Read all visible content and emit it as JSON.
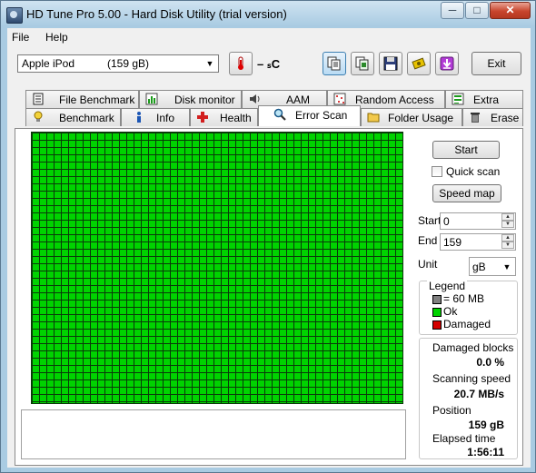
{
  "window": {
    "title": "HD Tune Pro 5.00 - Hard Disk Utility (trial version)",
    "controls": {
      "minimize": "─",
      "maximize": "□",
      "close": "✕"
    }
  },
  "menu": {
    "file": "File",
    "help": "Help"
  },
  "toolbar": {
    "drive_brand": "Apple",
    "drive_model": "iPod",
    "drive_size": "(159 gB)",
    "temperature": "– ₛC",
    "exit_label": "Exit"
  },
  "tabs": {
    "row1": [
      "File Benchmark",
      "Disk monitor",
      "AAM",
      "Random Access",
      "Extra tests"
    ],
    "row2": [
      "Benchmark",
      "Info",
      "Health",
      "Error Scan",
      "Folder Usage",
      "Erase"
    ],
    "selected": "Error Scan"
  },
  "scan": {
    "start_button": "Start",
    "quick_scan_label": "Quick scan",
    "quick_scan_checked": false,
    "speed_map_button": "Speed map",
    "start_label": "Start",
    "start_value": "0",
    "end_label": "End",
    "end_value": "159",
    "unit_label": "Unit",
    "unit_value": "gB"
  },
  "legend": {
    "title": "Legend",
    "block_size": "= 60 MB",
    "ok": "Ok",
    "damaged": "Damaged",
    "colors": {
      "block": "#808080",
      "ok": "#00d300",
      "damaged": "#d40000"
    }
  },
  "stats": {
    "damaged_blocks_label": "Damaged blocks",
    "damaged_blocks_value": "0.0 %",
    "scanning_speed_label": "Scanning speed",
    "scanning_speed_value": "20.7 MB/s",
    "position_label": "Position",
    "position_value": "159 gB",
    "elapsed_label": "Elapsed time",
    "elapsed_value": "1:56:11"
  },
  "colors": {
    "scan_ok": "#00d300",
    "grid_line": "#0a3a0a"
  }
}
